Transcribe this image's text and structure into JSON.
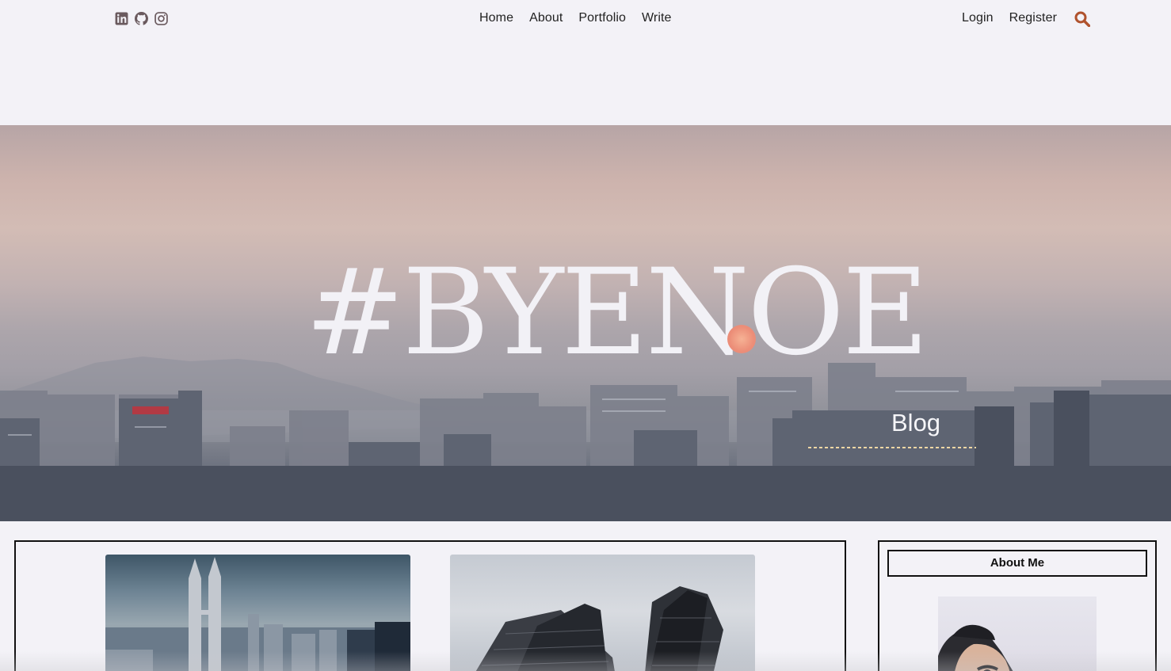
{
  "header": {
    "social": [
      {
        "icon": "linkedin-icon"
      },
      {
        "icon": "github-icon"
      },
      {
        "icon": "instagram-icon"
      }
    ],
    "nav": {
      "home": "Home",
      "about": "About",
      "portfolio": "Portfolio",
      "write": "Write"
    },
    "auth": {
      "login": "Login",
      "register": "Register"
    },
    "search_icon": "search-icon"
  },
  "hero": {
    "title": "#BYENOE",
    "subtitle": "Blog"
  },
  "sidebar": {
    "title": "About Me"
  },
  "colors": {
    "accent": "#b0522d",
    "background": "#f3f2f7",
    "hero_text": "#f2f1f6",
    "border": "#111111"
  }
}
